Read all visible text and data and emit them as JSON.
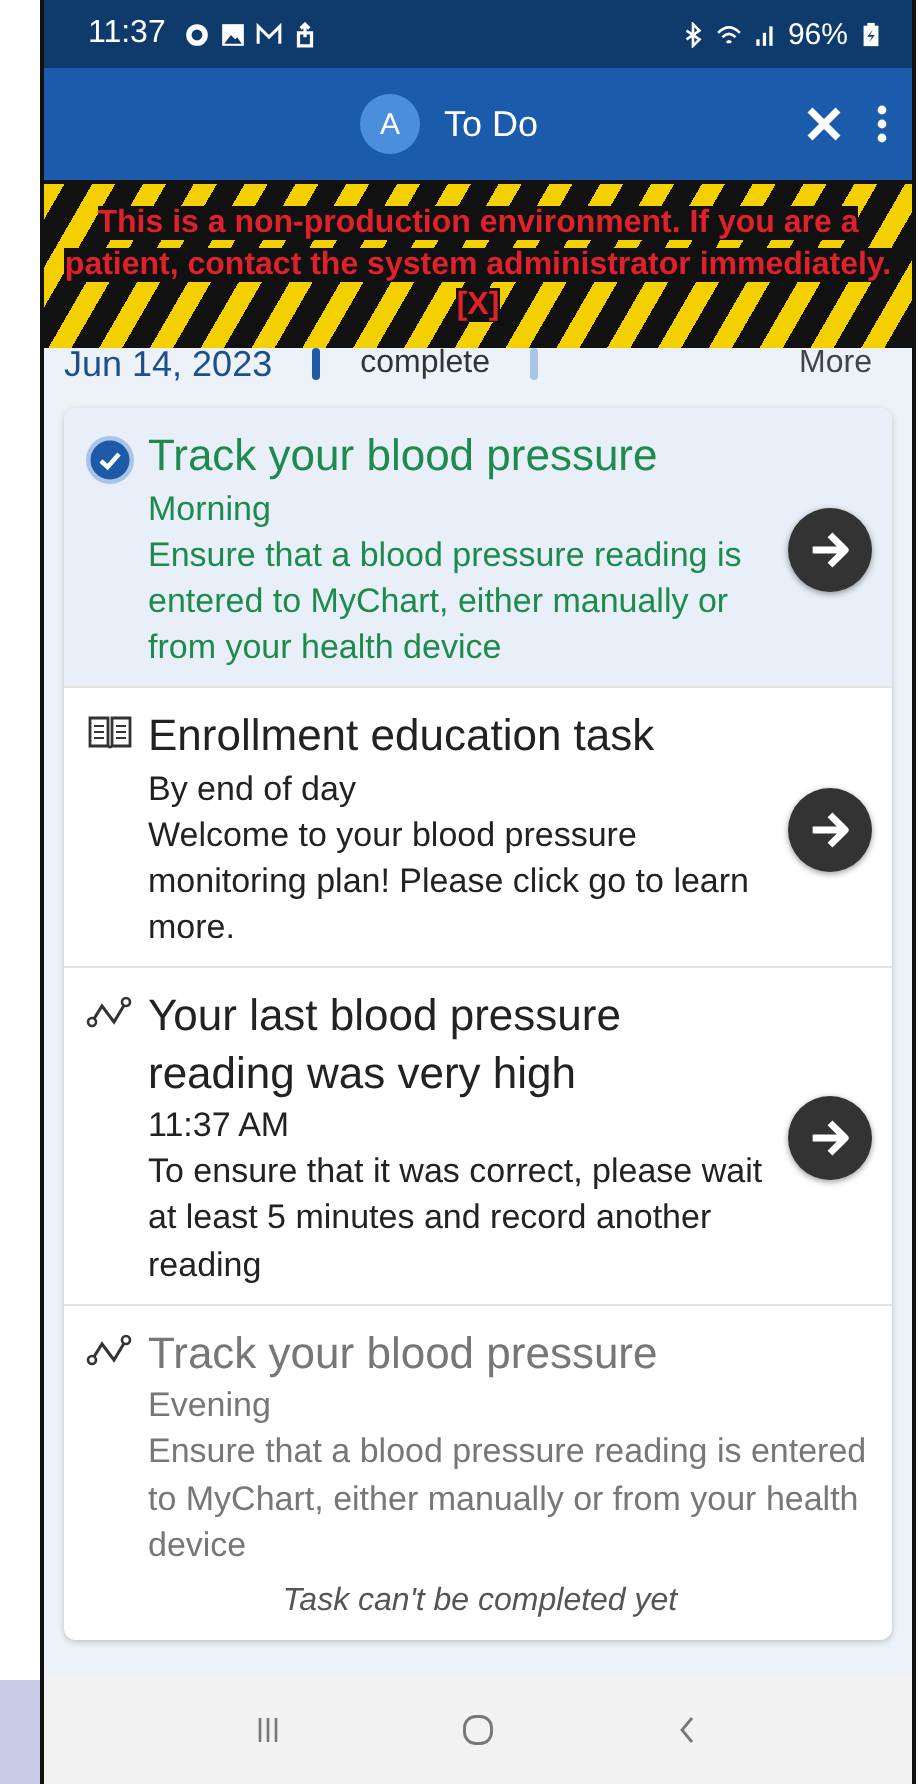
{
  "status_bar": {
    "time": "11:37",
    "battery": "96%"
  },
  "header": {
    "avatar": "A",
    "title": "To Do"
  },
  "banner": {
    "text": "This is a non-production environment. If you are a patient, contact the system administrator immediately. [X]"
  },
  "date_row": {
    "date": "Jun 14, 2023",
    "progress": "complete",
    "more": "More"
  },
  "tasks": [
    {
      "kind": "check",
      "done": true,
      "locked": false,
      "title": "Track your blood pressure",
      "when": "Morning",
      "description": "Ensure that a blood pressure reading is entered to MyChart, either manually or from your health device"
    },
    {
      "kind": "book",
      "done": false,
      "locked": false,
      "title": "Enrollment education task",
      "when": "By end of day",
      "description": "Welcome to your blood pressure monitoring plan! Please click go to learn more."
    },
    {
      "kind": "trend",
      "done": false,
      "locked": false,
      "title": "Your last blood pressure reading was very high",
      "when": "11:37 AM",
      "description": "To ensure that it was correct, please wait at least 5 minutes and record another reading"
    },
    {
      "kind": "trend",
      "done": false,
      "locked": true,
      "title": "Track your blood pressure",
      "when": "Evening",
      "description": "Ensure that a blood pressure reading is entered to MyChart, either manually or from your health device",
      "note": "Task can't be completed yet"
    }
  ]
}
